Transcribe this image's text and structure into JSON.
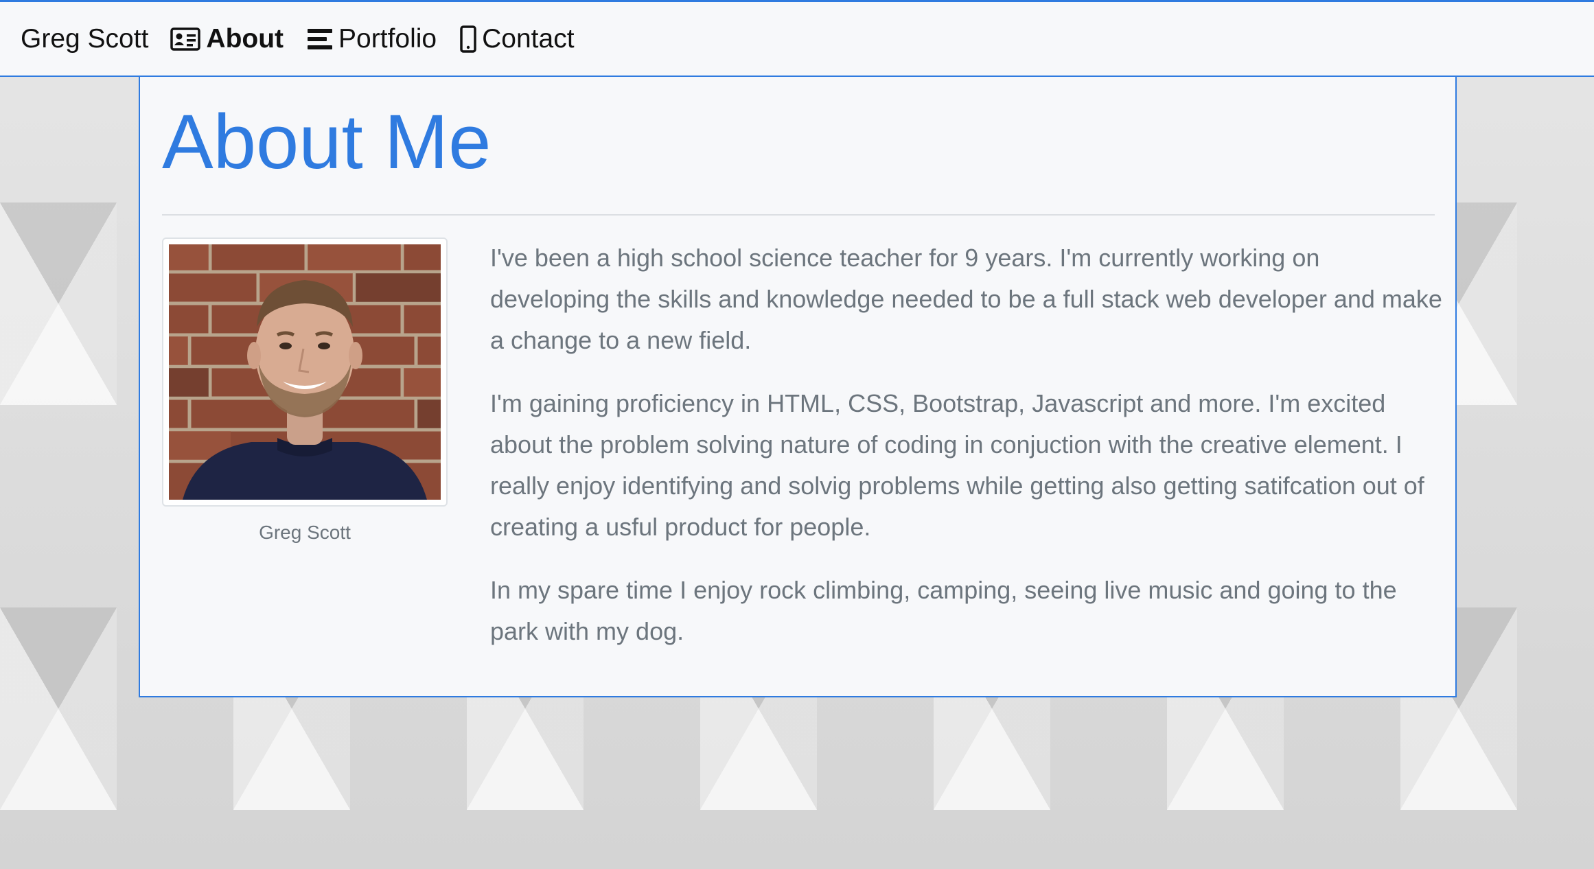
{
  "navbar": {
    "brand": "Greg Scott",
    "items": [
      {
        "label": "About",
        "icon": "id-card-icon",
        "active": true
      },
      {
        "label": "Portfolio",
        "icon": "bars-icon",
        "active": false
      },
      {
        "label": "Contact",
        "icon": "mobile-phone-icon",
        "active": false
      }
    ]
  },
  "about": {
    "title": "About Me",
    "caption": "Greg Scott",
    "paragraphs": [
      "I've been a high school science teacher for 9 years. I'm currently working on developing the skills and knowledge needed to be a full stack web developer and make a change to a new field.",
      "I'm gaining proficiency in HTML, CSS, Bootstrap, Javascript and more. I'm excited about the problem solving nature of coding in conjuction with the creative element. I really enjoy identifying and solvig problems while getting also getting satifcation out of creating a usful product for people.",
      "In my spare time I enjoy rock climbing, camping, seeing live music and going to the park with my dog."
    ]
  },
  "colors": {
    "accent": "#2f7be0",
    "text_muted": "#6c757d",
    "nav_text": "#111111",
    "panel_bg": "#f7f8fa"
  }
}
